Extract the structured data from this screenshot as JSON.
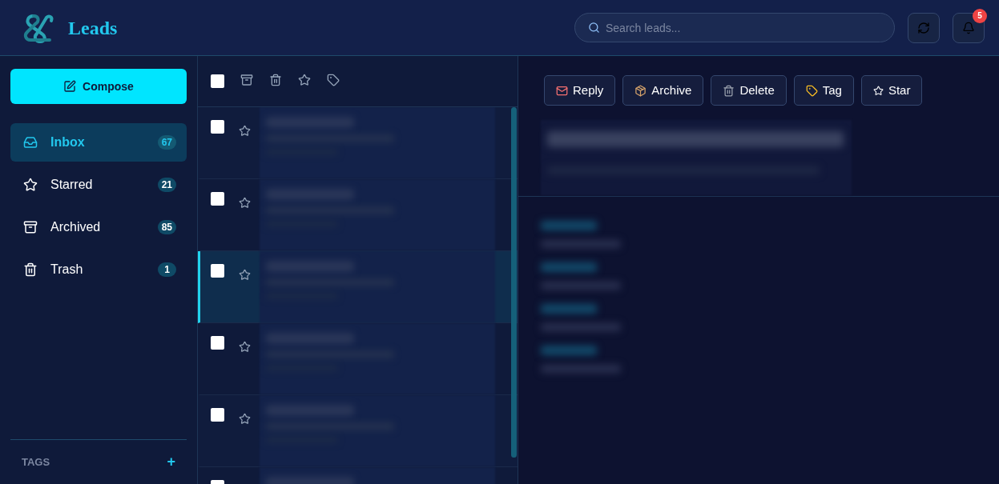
{
  "header": {
    "title": "Leads",
    "search": {
      "placeholder": "Search leads..."
    },
    "notifications": {
      "count": "5"
    }
  },
  "compose": {
    "label": "Compose"
  },
  "folders": [
    {
      "kind": "inbox",
      "label": "Inbox",
      "count": "67",
      "selected": true
    },
    {
      "kind": "star",
      "label": "Starred",
      "count": "21",
      "selected": false
    },
    {
      "kind": "archive",
      "label": "Archived",
      "count": "85",
      "selected": false
    },
    {
      "kind": "trash",
      "label": "Trash",
      "count": "1",
      "selected": false
    }
  ],
  "tags": {
    "heading": "TAGS",
    "add": "+"
  },
  "list": {
    "select_all": {
      "checked": false
    },
    "rows": [
      {
        "checked": false,
        "starred": false,
        "selected": false
      },
      {
        "checked": false,
        "starred": false,
        "selected": false
      },
      {
        "checked": false,
        "starred": false,
        "selected": true
      },
      {
        "checked": false,
        "starred": false,
        "selected": false
      },
      {
        "checked": false,
        "starred": false,
        "selected": false
      },
      {
        "checked": false,
        "selected": false
      }
    ]
  },
  "actions": [
    {
      "kind": "reply",
      "label": "Reply"
    },
    {
      "kind": "archive",
      "label": "Archive"
    },
    {
      "kind": "delete",
      "label": "Delete"
    },
    {
      "kind": "tag",
      "label": "Tag"
    },
    {
      "kind": "star",
      "label": "Star"
    }
  ]
}
